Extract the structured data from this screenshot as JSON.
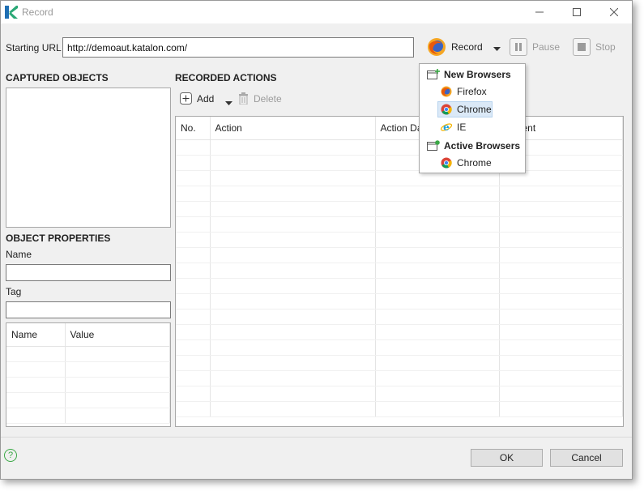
{
  "window": {
    "title": "Record"
  },
  "url": {
    "label": "Starting URL",
    "value": "http://demoaut.katalon.com/"
  },
  "toolbar": {
    "record_label": "Record",
    "pause_label": "Pause",
    "stop_label": "Stop"
  },
  "captured": {
    "title": "CAPTURED OBJECTS"
  },
  "properties": {
    "title": "OBJECT PROPERTIES",
    "name_label": "Name",
    "name_value": "",
    "tag_label": "Tag",
    "tag_value": "",
    "columns": [
      "Name",
      "Value"
    ]
  },
  "actions": {
    "title": "RECORDED ACTIONS",
    "add_label": "Add",
    "delete_label": "Delete",
    "columns": [
      "No.",
      "Action",
      "Action Da",
      "ent"
    ]
  },
  "menu": {
    "new_header": "New Browsers",
    "new_items": [
      "Firefox",
      "Chrome",
      "IE"
    ],
    "active_header": "Active Browsers",
    "active_items": [
      "Chrome"
    ]
  },
  "footer": {
    "help": "?",
    "ok_label": "OK",
    "cancel_label": "Cancel"
  },
  "colors": {
    "katalon_green": "#2aa876",
    "katalon_blue": "#1f6fb3",
    "selection": "#dbe9f7"
  }
}
